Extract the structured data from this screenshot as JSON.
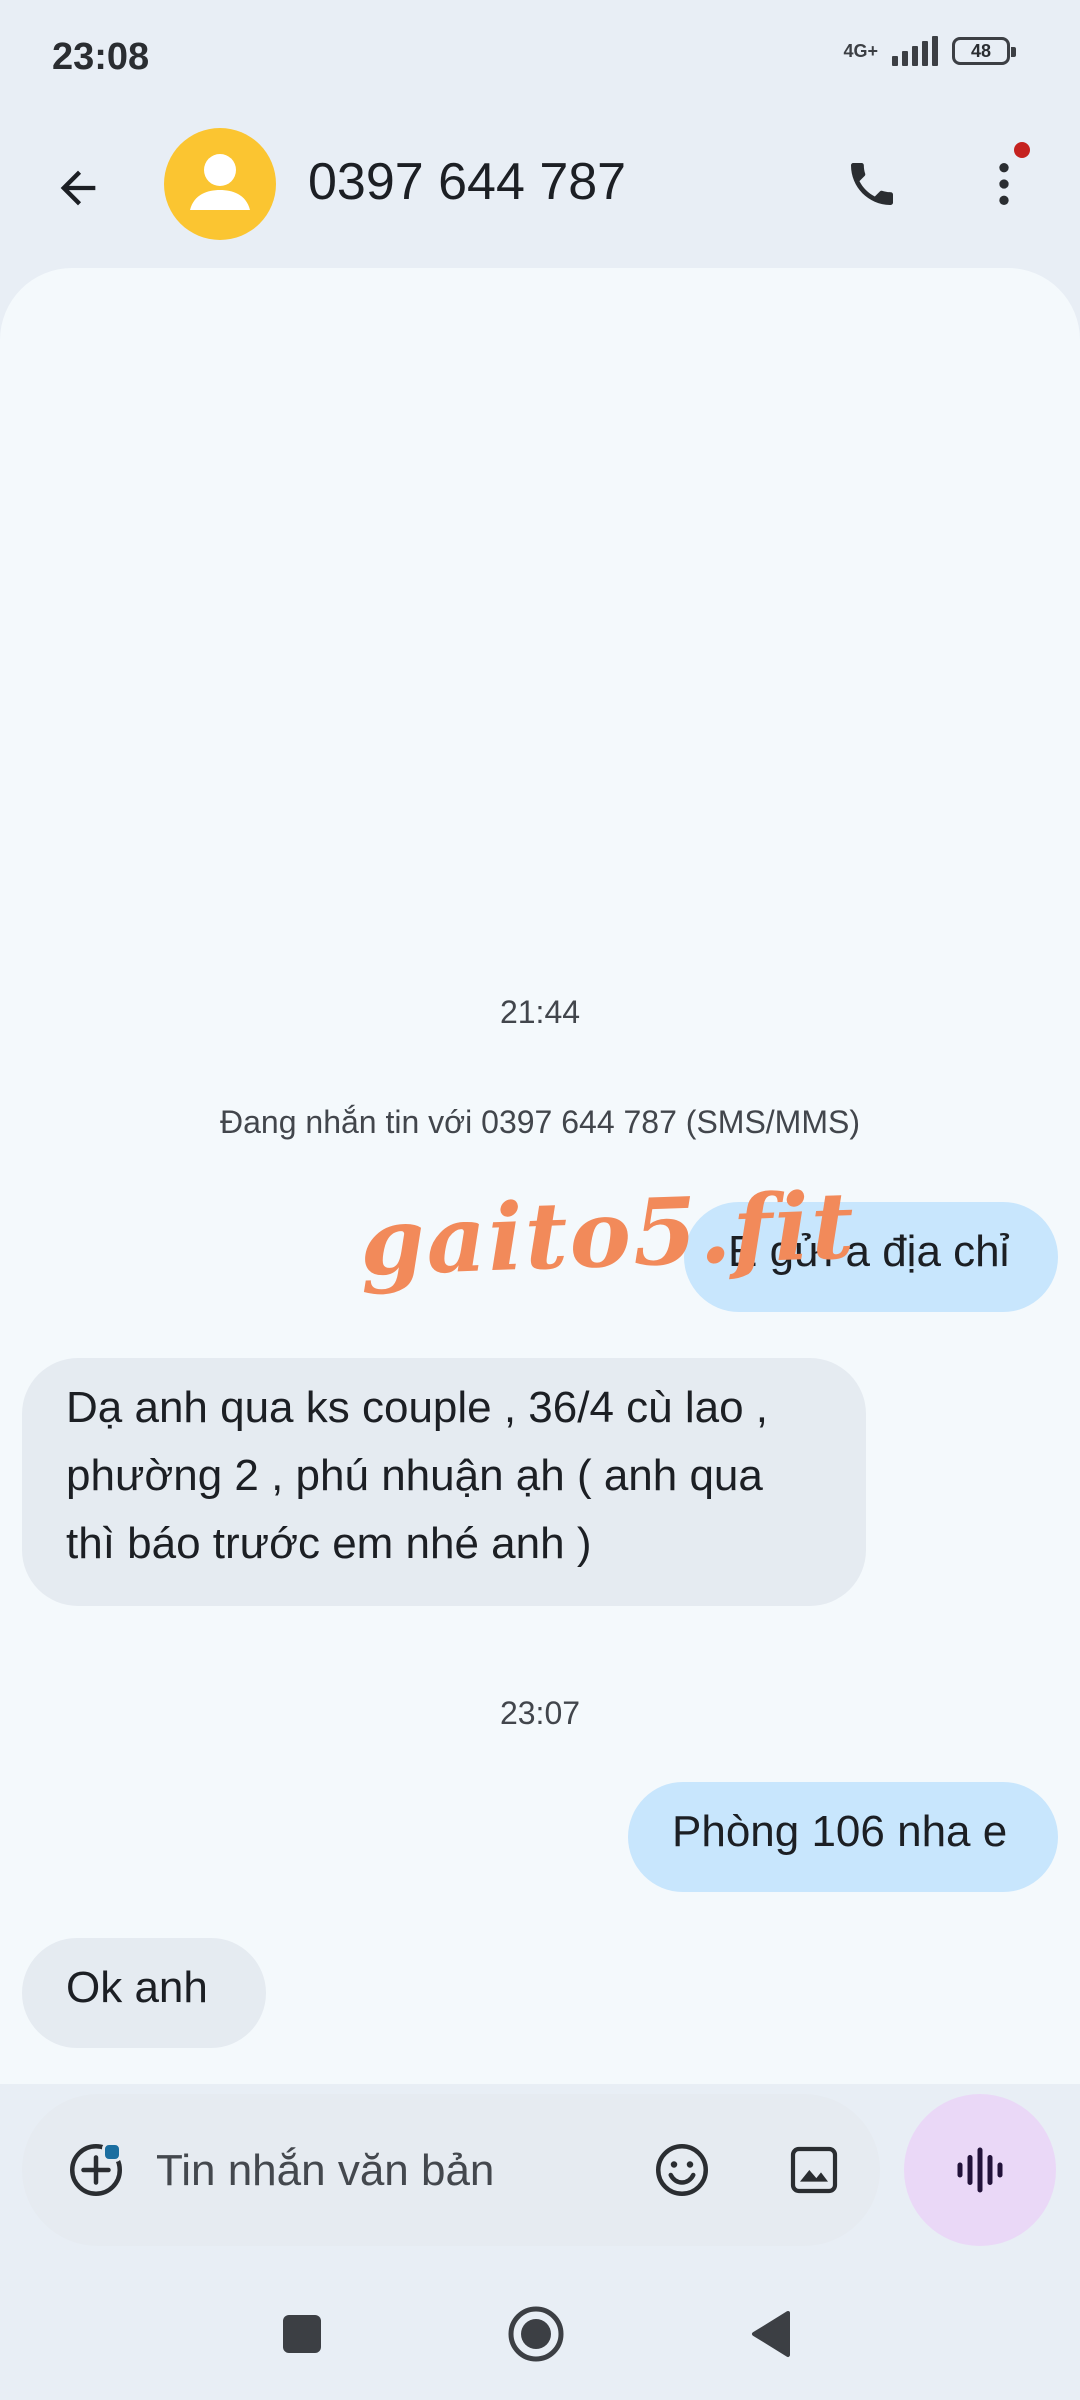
{
  "status_bar": {
    "time": "23:08",
    "network": "4G+",
    "battery": "48",
    "icons": [
      "signal-icon",
      "battery-icon"
    ]
  },
  "header": {
    "contact": "0397 644 787",
    "icons": [
      "back-arrow-icon",
      "person-icon",
      "phone-icon",
      "more-vert-icon"
    ]
  },
  "conversation": {
    "timestamp_1": "21:44",
    "info": "Đang nhắn tin với 0397 644 787 (SMS/MMS)",
    "message_1": "E gửi a địa chỉ",
    "message_2": "Dạ anh qua ks couple , 36/4 cù lao , phường 2 , phú nhuận ạh ( anh qua thì báo trước em nhé anh )",
    "timestamp_2": "23:07",
    "message_3": "Phòng 106 nha e",
    "message_4": "Ok anh",
    "watermark": "gaito5.fit"
  },
  "composer": {
    "placeholder": "Tin nhắn văn bản",
    "icons": [
      "add-circle-icon",
      "emoji-icon",
      "gallery-icon",
      "voice-waveform-icon"
    ]
  },
  "nav": {
    "icons": [
      "recents-icon",
      "home-icon",
      "back-triangle-icon"
    ]
  },
  "colors": {
    "background": "#e8eef5",
    "conversation_bg": "#f4f9fc",
    "outgoing_bubble": "#c8e6fd",
    "incoming_bubble": "#e5ebf1",
    "avatar": "#fbc531",
    "voice_button": "#ead8f7",
    "watermark": "#f28a5a",
    "notification_dot": "#c5221f"
  }
}
